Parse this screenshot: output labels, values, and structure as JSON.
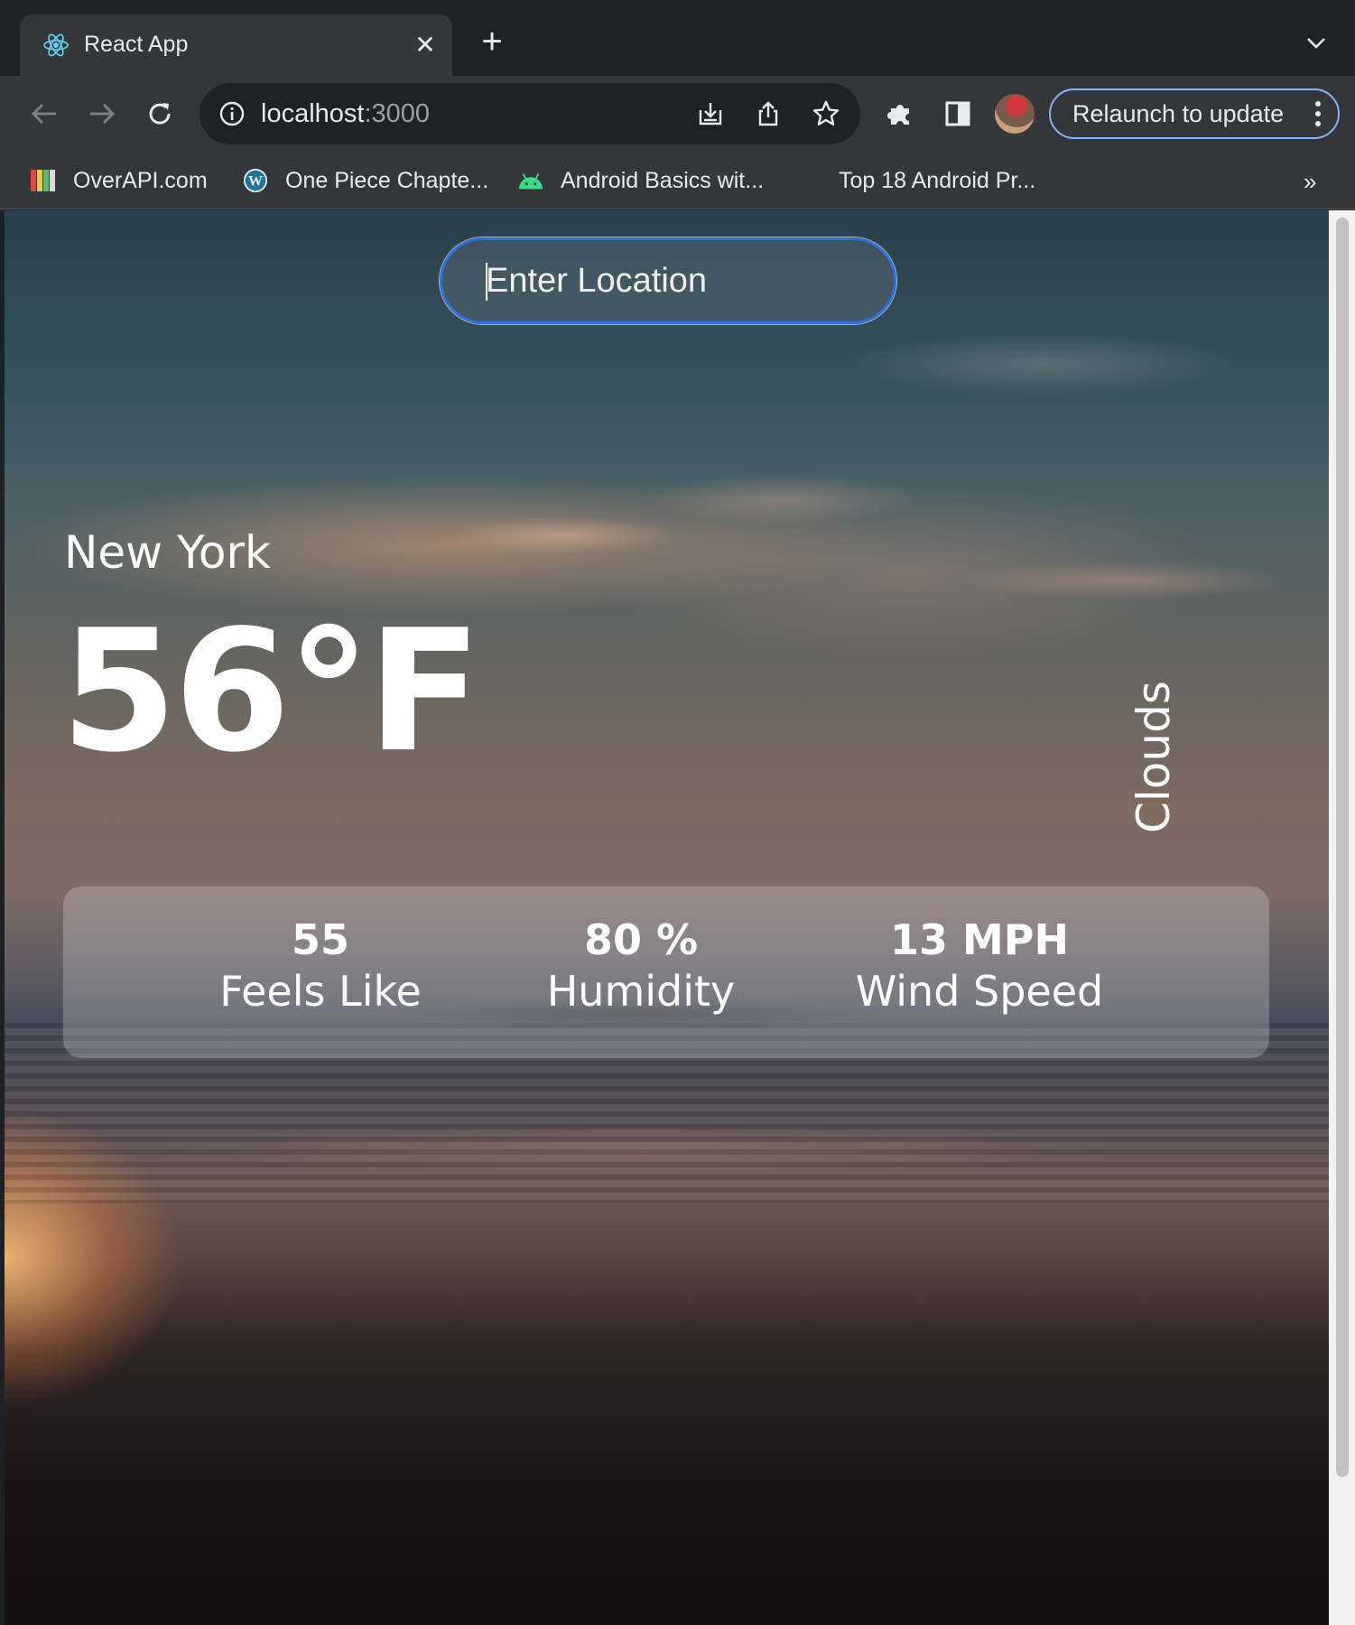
{
  "browser": {
    "tab": {
      "title": "React App",
      "favicon": "react-icon",
      "close": "✕"
    },
    "new_tab": "+",
    "url": {
      "host": "localhost",
      "port": ":3000"
    },
    "relaunch_label": "Relaunch to update",
    "bookmarks": [
      {
        "label": "OverAPI.com",
        "icon": "overapi-icon"
      },
      {
        "label": "One Piece Chapte...",
        "icon": "wordpress-icon"
      },
      {
        "label": "Android Basics wit...",
        "icon": "android-icon"
      },
      {
        "label": "Top 18 Android Pr...",
        "icon": ""
      }
    ],
    "more": "»"
  },
  "app": {
    "search": {
      "placeholder": "Enter Location",
      "value": ""
    },
    "city": "New York",
    "temperature": "56°F",
    "condition": "Clouds",
    "stats": [
      {
        "value": "55",
        "label": "Feels Like"
      },
      {
        "value": "80 %",
        "label": "Humidity"
      },
      {
        "value": "13 MPH",
        "label": "Wind Speed"
      }
    ]
  },
  "colors": {
    "chrome_dark": "#202124",
    "chrome_toolbar": "#35363a",
    "focus_ring": "#2f6fe0",
    "relaunch_border": "#8ab4f8"
  }
}
